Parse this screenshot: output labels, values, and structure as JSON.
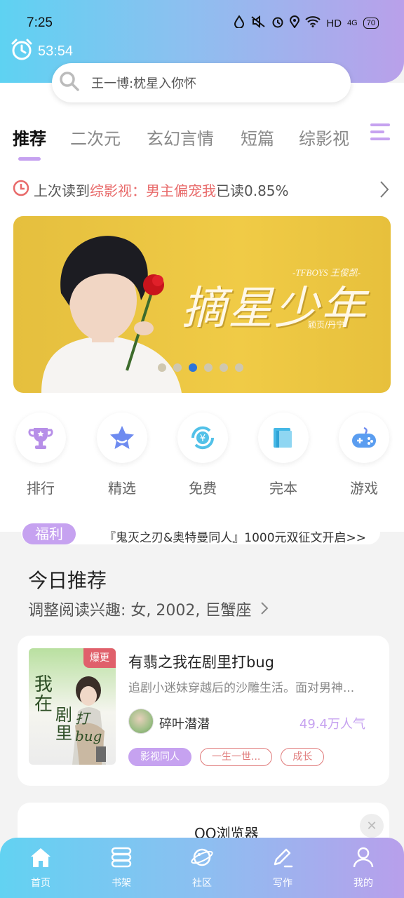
{
  "status_bar": {
    "time": "7:25",
    "hd": "HD",
    "network": "4G",
    "battery": "70"
  },
  "timer": {
    "value": "53:54"
  },
  "search": {
    "placeholder": "王一博:枕星入你怀"
  },
  "tabs": [
    {
      "label": "推荐",
      "active": true
    },
    {
      "label": "二次元"
    },
    {
      "label": "玄幻言情"
    },
    {
      "label": "短篇"
    },
    {
      "label": "综影视"
    }
  ],
  "last_read": {
    "prefix": "上次读到",
    "book": "综影视：男主偏宠我",
    "suffix": "已读0.85%"
  },
  "banner": {
    "title": "摘星少年",
    "subtitle": "-TFBOYS 王俊凯-",
    "author": "颖页/丹宁",
    "slide_index": 3,
    "slide_count": 6
  },
  "categories": [
    {
      "label": "排行",
      "icon": "trophy-icon"
    },
    {
      "label": "精选",
      "icon": "star-icon"
    },
    {
      "label": "免费",
      "icon": "yen-refresh-icon"
    },
    {
      "label": "完本",
      "icon": "book-icon"
    },
    {
      "label": "游戏",
      "icon": "gamepad-icon"
    }
  ],
  "notice": {
    "tag": "福利",
    "text": "『鬼灭之刃&奥特曼同人』1000元双征文开启>>"
  },
  "today": {
    "title": "今日推荐",
    "subtitle": "调整阅读兴趣: 女, 2002, 巨蟹座"
  },
  "book": {
    "badge": "爆更",
    "cover_line1": "我在",
    "cover_line2": "剧里",
    "cover_line3": "打bug",
    "title": "有翡之我在剧里打bug",
    "description": "追剧小迷妹穿越后的沙雕生活。面对男神...",
    "author": "碎叶潜潜",
    "popularity": "49.4万人气",
    "tags": [
      "影视同人",
      "一生一世...",
      "成长"
    ]
  },
  "ad_card": {
    "text": "QQ浏览器"
  },
  "bottom_nav": [
    {
      "label": "首页",
      "icon": "home-icon"
    },
    {
      "label": "书架",
      "icon": "bookshelf-icon"
    },
    {
      "label": "社区",
      "icon": "planet-icon"
    },
    {
      "label": "写作",
      "icon": "pen-icon"
    },
    {
      "label": "我的",
      "icon": "user-icon"
    }
  ],
  "colors": {
    "accent": "#c6a2f0",
    "highlight_red": "#e86a6a",
    "header_start": "#5ed2f2",
    "header_end": "#b9a0ea"
  }
}
